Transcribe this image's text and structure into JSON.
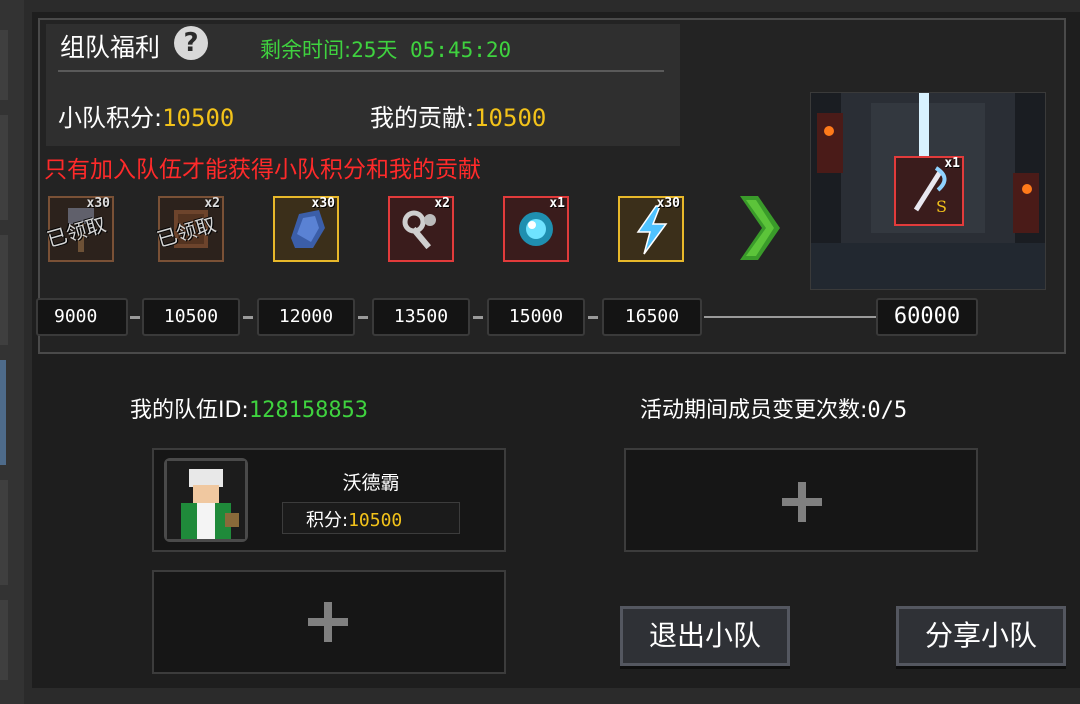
{
  "header": {
    "title": "组队福利",
    "help_icon": "?",
    "remaining_label": "剩余时间:",
    "remaining_value": "25天 05:45:20",
    "team_score_label": "小队积分:",
    "team_score_value": "10500",
    "contribution_label": "我的贡献:",
    "contribution_value": "10500"
  },
  "notice": "只有加入队伍才能获得小队积分和我的贡献",
  "rewards": [
    {
      "icon": "hammer-icon",
      "qty": "x30",
      "claimed_label": "已领取",
      "threshold": "9000"
    },
    {
      "icon": "scroll-icon",
      "qty": "x2",
      "claimed_label": "已领取",
      "threshold": "10500"
    },
    {
      "icon": "ore-icon",
      "qty": "x30",
      "threshold": "12000"
    },
    {
      "icon": "key-icon",
      "qty": "x2",
      "threshold": "13500"
    },
    {
      "icon": "orb-icon",
      "qty": "x1",
      "threshold": "15000"
    },
    {
      "icon": "lightning-icon",
      "qty": "x30",
      "threshold": "16500"
    }
  ],
  "final_reward": {
    "icon": "staff-icon",
    "qty": "x1",
    "threshold": "60000"
  },
  "team": {
    "id_label": "我的队伍ID:",
    "id_value": "128158853",
    "change_label": "活动期间成员变更次数:",
    "change_value": "0/5",
    "member": {
      "name": "沃德霸",
      "score_label": "积分:",
      "score_value": "10500"
    },
    "add_icon": "plus-icon"
  },
  "buttons": {
    "leave": "退出小队",
    "share": "分享小队"
  },
  "colors": {
    "green": "#3fd23f",
    "yellow": "#f2c21a",
    "red": "#ff2a2a"
  }
}
